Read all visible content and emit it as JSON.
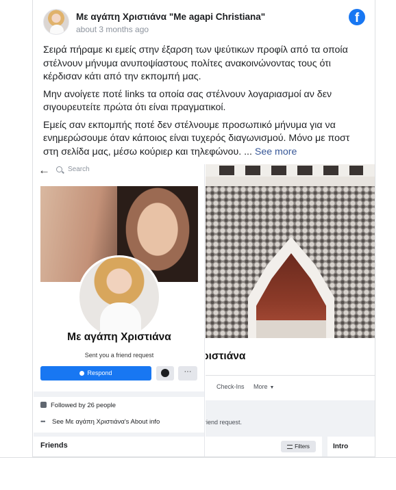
{
  "post": {
    "page_name": "Με αγάπη Χριστιάνα \"Me agapi Christiana\"",
    "timestamp": "about 3 months ago",
    "fb_glyph": "f",
    "paragraph1": "Σειρά πήραμε κι εμείς στην έξαρση των ψεύτικων προφίλ από τα οποία στέλνουν μήνυμα ανυποψίαστους πολίτες ανακοινώνοντας τους ότι κέρδισαν κάτι από την εκπομπή μας.",
    "paragraph2": "Μην ανοίγετε ποτέ links τα οποία σας στέλνουν λογαριασμοί αν δεν σιγουρευτείτε πρώτα ότι είναι πραγματικοί.",
    "paragraph3": "Εμείς σαν εκπομπής ποτέ δεν στέλνουμε προσωπικό μήνυμα για να ενημερώσουμε όταν κάποιος είναι τυχερός διαγωνισμού. Μόνο με ποστ στη σελίδα μας, μέσω κούριερ και τηλεφώνου. ...",
    "see_more": "See more"
  },
  "phone": {
    "back_glyph": "←",
    "search_placeholder": "Search",
    "profile_name": "Με αγάπη Χριστιάνα",
    "friend_request_text": "Sent you a friend request",
    "respond_label": "Respond",
    "more_glyph": "···",
    "followed_by": "Followed by 26 people",
    "dots_glyph": "•••",
    "about_info": "See Με αγάπη Χριστιάνα's About info",
    "friends_label": "Friends"
  },
  "desktop": {
    "profile_name": "ριστιάνα",
    "tab_checkins": "Check-Ins",
    "tab_more": "More",
    "chevron_glyph": "▼",
    "friend_request_text": "riend request.",
    "filters_label": "Filters",
    "intro_label": "Intro"
  },
  "colors": {
    "accent": "#1877f2",
    "link": "#385898",
    "meta_text": "#8d949e"
  }
}
